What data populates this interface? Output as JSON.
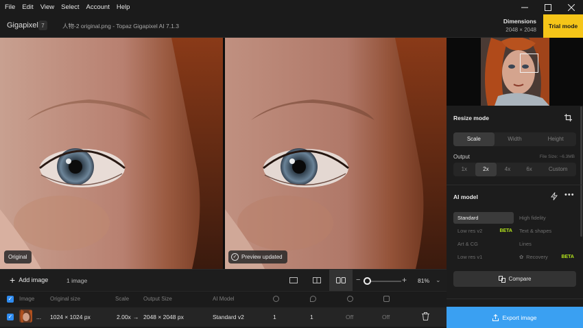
{
  "menu": [
    "File",
    "Edit",
    "View",
    "Select",
    "Account",
    "Help"
  ],
  "window_controls": {
    "minimize": "—",
    "maximize": "☐",
    "close": "✕"
  },
  "header": {
    "app_name": "Gigapixel",
    "version_badge": "7",
    "file_title": "人物-2 original.png - Topaz Gigapixel AI 7.1.3",
    "dimensions_label": "Dimensions",
    "dimensions_value": "2048 × 2048",
    "trial_button": "Trial mode"
  },
  "preview": {
    "original_tag": "Original",
    "preview_tag": "Preview updated"
  },
  "toolbar": {
    "add_image": "Add image",
    "image_count": "1 image",
    "zoom_value": "81%",
    "zoom_level_fraction": 0.1
  },
  "table": {
    "headers": {
      "image": "Image",
      "original_size": "Original size",
      "scale": "Scale",
      "output_size": "Output Size",
      "ai_model": "AI Model"
    },
    "rows": [
      {
        "ellipsis": "...",
        "original_size": "1024 × 1024 px",
        "scale": "2.00x",
        "arrow": "→",
        "output_size": "2048 × 2048 px",
        "ai_model": "Standard v2",
        "col_a": "1",
        "col_b": "1",
        "col_c": "Off",
        "col_d": "Off"
      }
    ]
  },
  "panel": {
    "resize_mode_title": "Resize mode",
    "resize_tabs": [
      "Scale",
      "Width",
      "Height"
    ],
    "resize_active": "Scale",
    "output_label": "Output",
    "file_size": "File Size: ~6.3MB",
    "scale_options": [
      "1x",
      "2x",
      "4x",
      "6x",
      "Custom"
    ],
    "scale_active": "2x",
    "ai_model_title": "AI model",
    "models": {
      "standard": "Standard",
      "high_fidelity": "High fidelity",
      "low_res_v2": "Low res v2",
      "text_shapes": "Text & shapes",
      "art_cg": "Art & CG",
      "lines": "Lines",
      "low_res_v1": "Low res v1",
      "recovery": "Recovery",
      "beta": "BETA"
    },
    "compare_button": "Compare",
    "export_button": "Export image"
  },
  "colors": {
    "accent_blue": "#3aa0f2",
    "trial_yellow": "#f5c518",
    "beta_green": "#b5e61d"
  }
}
